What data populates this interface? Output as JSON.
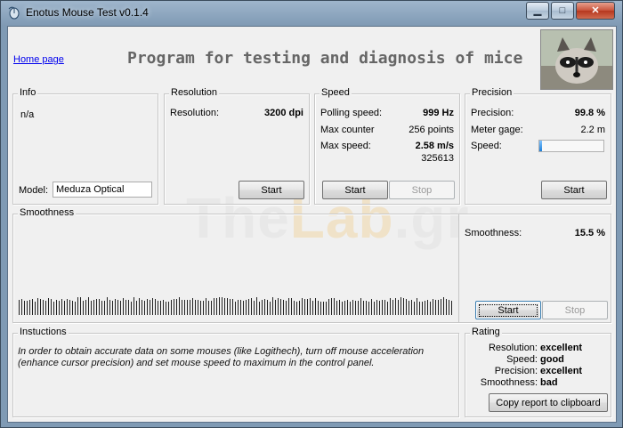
{
  "window": {
    "title": "Enotus Mouse Test v0.1.4",
    "controls": {
      "minimize": "▁",
      "maximize": "□",
      "close": "✕"
    }
  },
  "header": {
    "home_link": "Home page",
    "heading": "Program for testing and diagnosis of mice"
  },
  "watermark": {
    "part1": "The",
    "part2": "Lab",
    "part3": ".gr"
  },
  "info": {
    "label": "Info",
    "status": "n/a",
    "model_label": "Model:",
    "model_value": "Meduza Optical"
  },
  "resolution": {
    "label": "Resolution",
    "field_label": "Resolution:",
    "value": "3200 dpi",
    "start_button": "Start"
  },
  "speed": {
    "label": "Speed",
    "polling_label": "Polling speed:",
    "polling_value": "999 Hz",
    "counter_label": "Max counter",
    "counter_value": "256 points",
    "maxspeed_label": "Max  speed:",
    "maxspeed_value": "2.58 m/s",
    "raw_value": "325613",
    "start_button": "Start",
    "stop_button": "Stop"
  },
  "precision": {
    "label": "Precision",
    "precision_label": "Precision:",
    "precision_value": "99.8 %",
    "gage_label": "Meter gage:",
    "gage_value": "2.2 m",
    "speed_label": "Speed:",
    "speed_level": 0.04,
    "start_button": "Start"
  },
  "smoothness": {
    "label": "Smoothness",
    "field_label": "Smoothness:",
    "value": "15.5 %",
    "start_button": "Start",
    "stop_button": "Stop"
  },
  "instructions": {
    "label": "Instuctions",
    "text": "In order to obtain accurate data on some mouses (like Logithech), turn off mouse acceleration (enhance cursor precision) and set mouse speed to maximum in the control panel."
  },
  "rating": {
    "label": "Rating",
    "rows": [
      {
        "name": "Resolution:",
        "value": "excellent"
      },
      {
        "name": "Speed:",
        "value": "good"
      },
      {
        "name": "Precision:",
        "value": "excellent"
      },
      {
        "name": "Smoothness:",
        "value": "bad"
      }
    ],
    "copy_button": "Copy report to clipboard"
  },
  "colors": {
    "titlebar": "#7f9ab4",
    "client": "#f0f0f0",
    "link": "#0000ee",
    "progress": "#1e7fd8",
    "close": "#c8523a"
  }
}
